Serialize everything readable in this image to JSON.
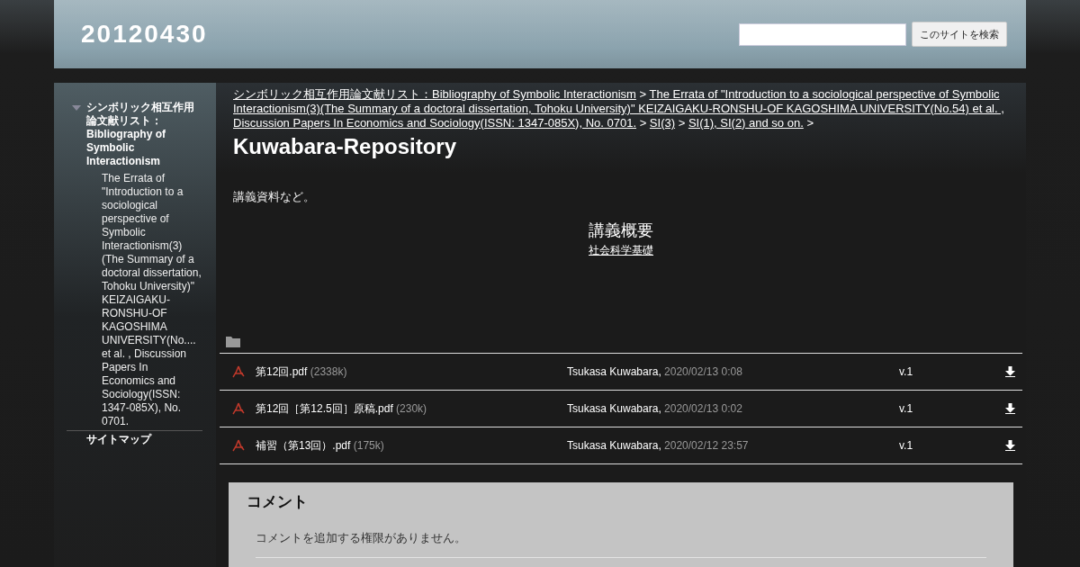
{
  "header": {
    "site_title": "20120430",
    "search": {
      "button": "このサイトを検索"
    }
  },
  "sidebar": {
    "items": [
      {
        "label": "シンボリック相互作用論文献リスト：Bibliography of Symbolic Interactionism",
        "expanded": true,
        "children": [
          {
            "label": "The Errata of \"Introduction to a sociological perspective of Symbolic Interactionism(3)(The Summary of a doctoral dissertation, Tohoku University)\" KEIZAIGAKU-RONSHU-OF KAGOSHIMA UNIVERSITY(No.... et al. , Discussion Papers In Economics and Sociology(ISSN: 1347-085X), No. 0701."
          }
        ]
      },
      {
        "label": "サイトマップ",
        "expanded": false
      }
    ]
  },
  "breadcrumb": {
    "separator": ">",
    "links": [
      "シンボリック相互作用論文献リスト：Bibliography of Symbolic Interactionism",
      "The Errata of \"Introduction to a sociological perspective of Symbolic Interactionism(3)(The Summary of a doctoral dissertation, Tohoku University)\" KEIZAIGAKU-RONSHU-OF KAGOSHIMA UNIVERSITY(No.54) et al. , Discussion Papers In Economics and Sociology(ISSN: 1347-085X), No. 0701.",
      "SI(3)",
      "SI(1), SI(2) and so on."
    ]
  },
  "page_title": "Kuwabara-Repository",
  "intro": "講義資料など。",
  "overview": {
    "heading": "講義概要",
    "link": "社会科学基礎"
  },
  "files": [
    {
      "name": "第12回.pdf",
      "size": "(2338k)",
      "author": "Tsukasa Kuwabara,",
      "date": "2020/02/13 0:08",
      "version": "v.1"
    },
    {
      "name": "第12回［第12.5回］原稿.pdf",
      "size": "(230k)",
      "author": "Tsukasa Kuwabara,",
      "date": "2020/02/13 0:02",
      "version": "v.1"
    },
    {
      "name": "補習（第13回）.pdf",
      "size": "(175k)",
      "author": "Tsukasa Kuwabara,",
      "date": "2020/02/12 23:57",
      "version": "v.1"
    }
  ],
  "comments": {
    "heading": "コメント",
    "notice": "コメントを追加する権限がありません。"
  }
}
